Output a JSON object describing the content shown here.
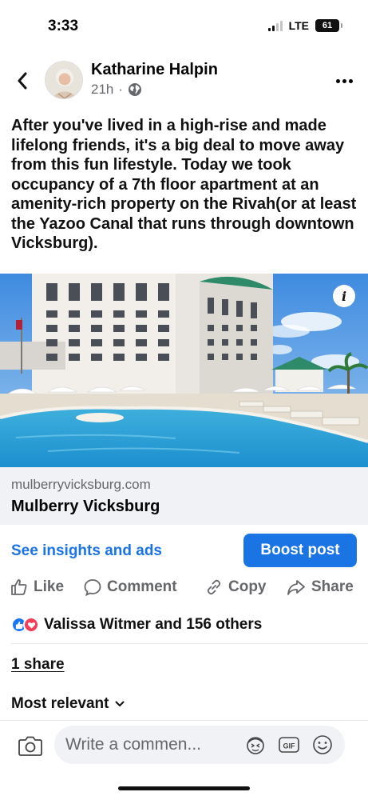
{
  "status_bar": {
    "time": "3:33",
    "network": "LTE",
    "battery": "61"
  },
  "header": {
    "author": "Katharine Halpin",
    "time_ago": "21h",
    "separator": "·",
    "audience_icon": "globe-icon"
  },
  "post": {
    "text": "After you've lived in a high-rise and made lifelong friends, it's a big deal to move away from this fun lifestyle. Today we took occupancy of a 7th floor apartment at an amenity-rich property on the Rivah(or at least the Yazoo Canal that runs through downtown Vicksburg)."
  },
  "link_preview": {
    "info_label": "i",
    "domain": "mulberryvicksburg.com",
    "title": "Mulberry Vicksburg"
  },
  "insights": {
    "link_label": "See insights and ads",
    "boost_label": "Boost post"
  },
  "actions": {
    "like": "Like",
    "comment": "Comment",
    "copy": "Copy",
    "share": "Share"
  },
  "reactions": {
    "summary": "Valissa Witmer and 156 others"
  },
  "shares": {
    "label": "1 share"
  },
  "comments": {
    "sort_label": "Most relevant",
    "input_placeholder": "Write a commen..."
  },
  "colors": {
    "brand_blue": "#1b74e4",
    "secondary_text": "#65676b",
    "love_red": "#f33e58",
    "input_bg": "#f0f2f5"
  }
}
